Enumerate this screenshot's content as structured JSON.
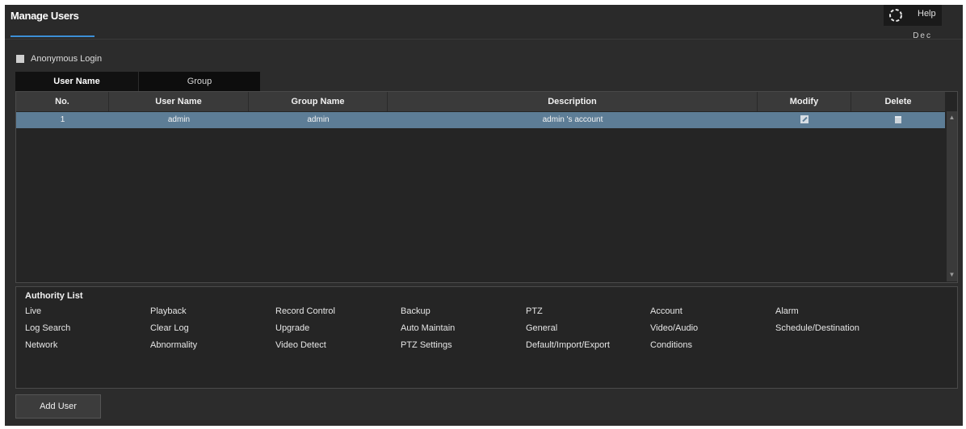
{
  "header": {
    "title": "Manage Users",
    "help_label": "Help",
    "corner_text": "Dec"
  },
  "anonymous_login": {
    "label": "Anonymous Login",
    "checked": false
  },
  "tabs": [
    {
      "label": "User Name",
      "active": true
    },
    {
      "label": "Group",
      "active": false
    }
  ],
  "table": {
    "columns": [
      "No.",
      "User Name",
      "Group Name",
      "Description",
      "Modify",
      "Delete"
    ],
    "rows": [
      {
        "no": "1",
        "user_name": "admin",
        "group_name": "admin",
        "description": "admin 's account",
        "modify_icon": "edit-icon",
        "delete_icon": "trash-icon",
        "selected_color": "#5d7d96"
      }
    ]
  },
  "authority": {
    "title": "Authority List",
    "items": [
      "Live",
      "Playback",
      "Record Control",
      "Backup",
      "PTZ",
      "Account",
      "Alarm",
      "Log Search",
      "Clear Log",
      "Upgrade",
      "Auto Maintain",
      "General",
      "Video/Audio",
      "Schedule/Destination",
      "Network",
      "Abnormality",
      "Video Detect",
      "PTZ Settings",
      "Default/Import/Export",
      "Conditions"
    ]
  },
  "actions": {
    "add_user_label": "Add User"
  },
  "colors": {
    "background": "#2c2c2c",
    "accent": "#3d8fd6",
    "selected_row": "#5d7d96"
  }
}
